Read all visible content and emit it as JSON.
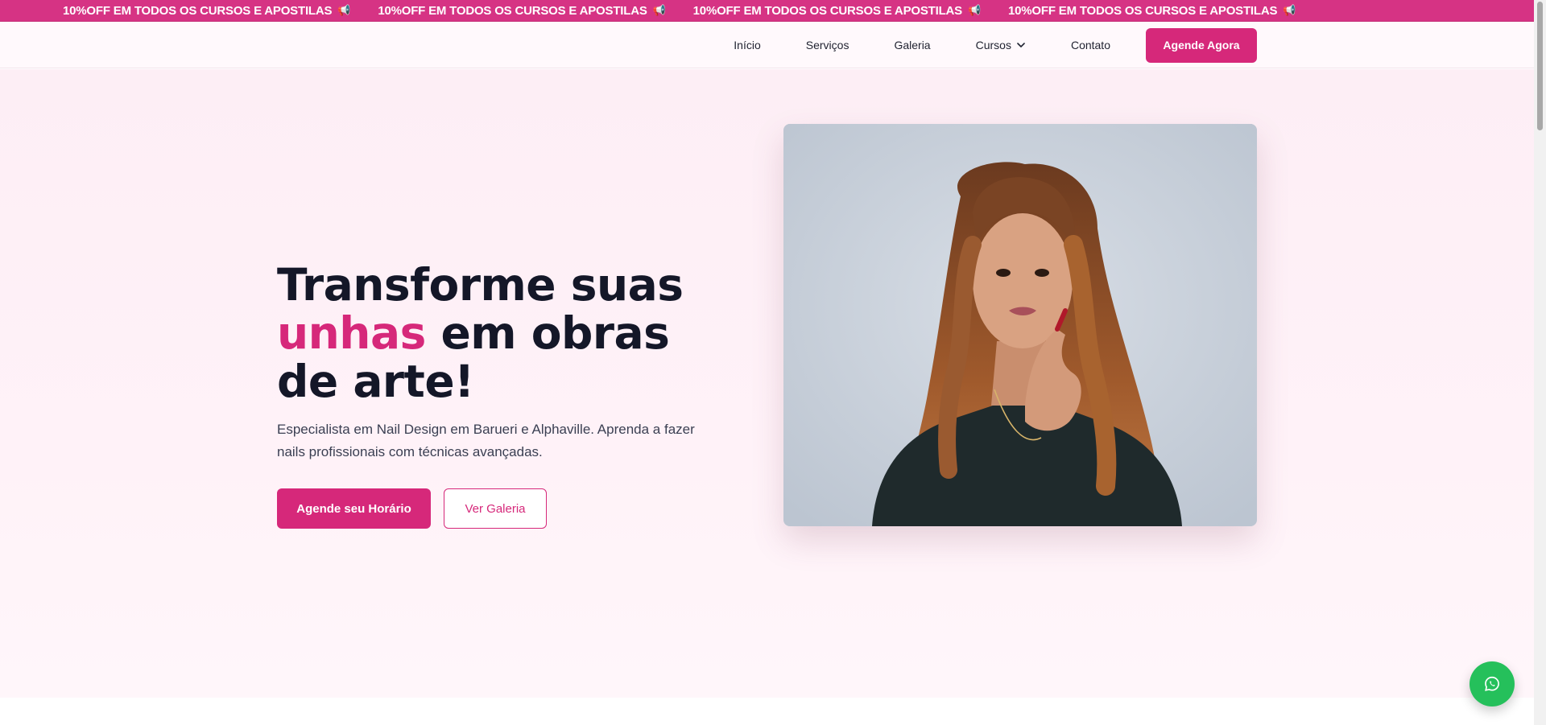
{
  "promo": {
    "items": [
      "10%OFF EM TODOS OS CURSOS E APOSTILAS",
      "10%OFF EM TODOS OS CURSOS E APOSTILAS",
      "10%OFF EM TODOS OS CURSOS E APOSTILAS",
      "10%OFF EM TODOS OS CURSOS E APOSTILAS"
    ],
    "icon": "megaphone-icon",
    "background": "#d63384"
  },
  "nav": {
    "links": [
      "Início",
      "Serviços",
      "Galeria",
      "Cursos",
      "Contato"
    ],
    "cta": "Agende Agora"
  },
  "hero": {
    "title_line1": "Transforme suas",
    "title_accent": "unhas",
    "title_rest": " em obras de arte!",
    "subtitle": "Especialista em Nail Design em Barueri e Alphaville. Aprenda a fazer nails profissionais com técnicas avançadas.",
    "primary_button": "Agende seu Horário",
    "secondary_button": "Ver Galeria"
  },
  "colors": {
    "accent": "#d6287a",
    "heading": "#141728",
    "whatsapp": "#25c05b"
  }
}
